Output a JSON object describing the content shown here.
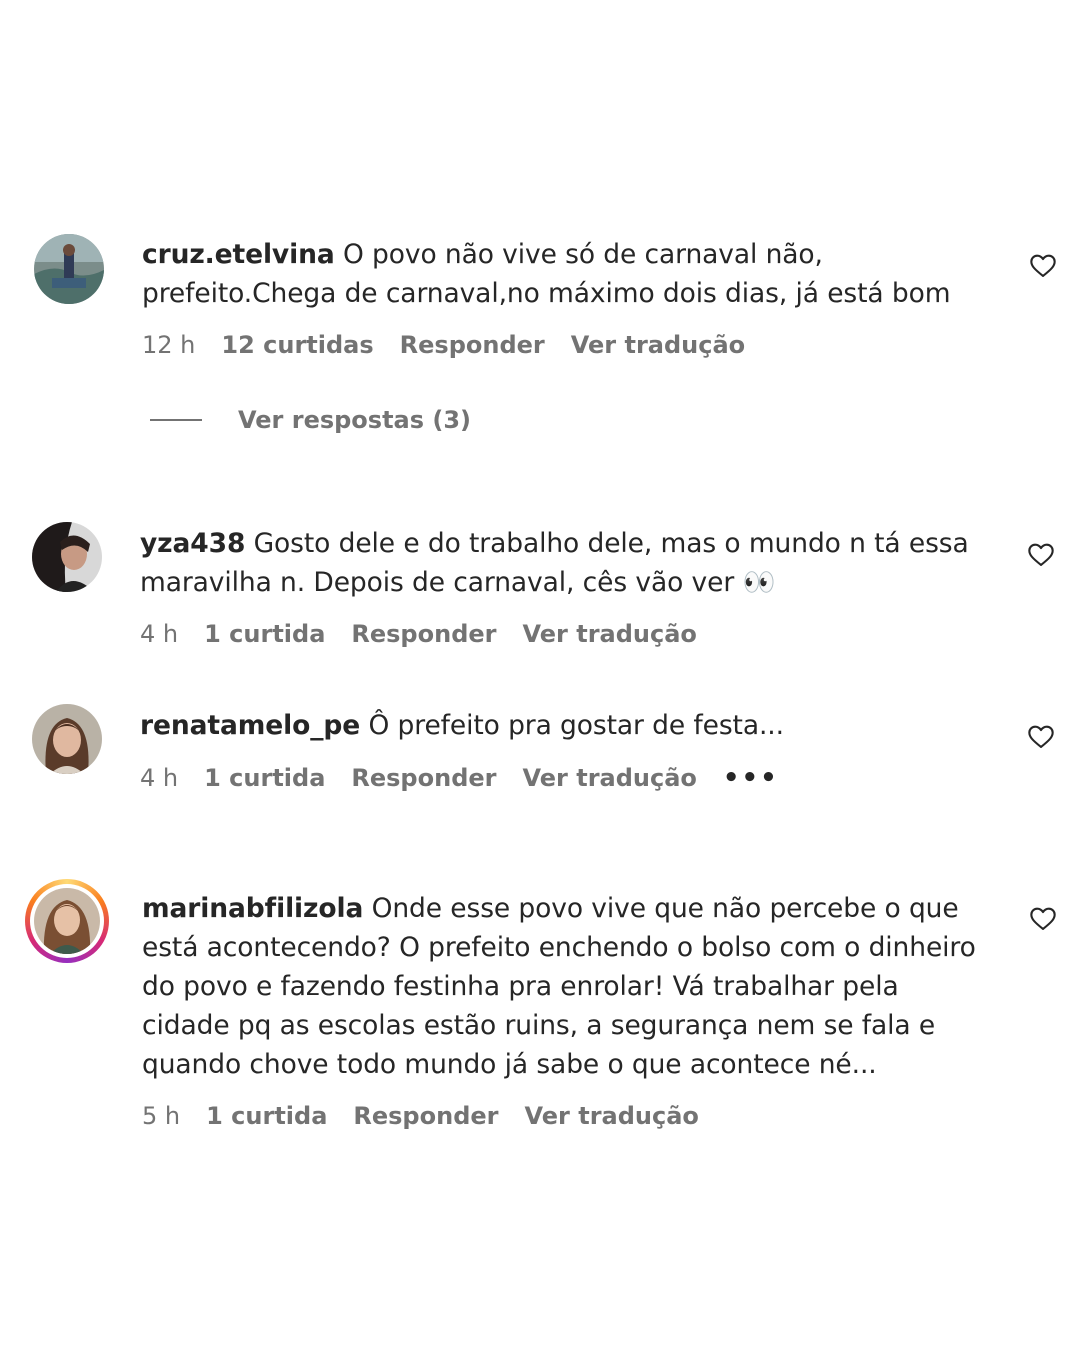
{
  "comments": [
    {
      "username": "cruz.etelvina",
      "text": "O povo não vive só de carnaval não, prefeito.Chega de carnaval,no máximo dois dias, já está bom",
      "time": "12 h",
      "likes": "12 curtidas",
      "reply": "Responder",
      "translate": "Ver tradução",
      "view_replies": "Ver respostas (3)"
    },
    {
      "username": "yza438",
      "text": "Gosto dele e do trabalho dele, mas o mundo n tá essa maravilha n. Depois de carnaval, cês vão ver 👀",
      "time": "4 h",
      "likes": "1 curtida",
      "reply": "Responder",
      "translate": "Ver tradução"
    },
    {
      "username": "renatamelo_pe",
      "text": "Ô prefeito pra gostar de festa...",
      "time": "4 h",
      "likes": "1 curtida",
      "reply": "Responder",
      "translate": "Ver tradução",
      "more": "•••"
    },
    {
      "username": "marinabfilizola",
      "text": "Onde esse povo vive que não percebe o que está acontecendo? O prefeito enchendo o bolso com o dinheiro do povo e fazendo festinha pra enrolar! Vá trabalhar pela cidade pq as escolas estão ruins, a segurança nem se fala e quando chove todo mundo já sabe o que acontece né...",
      "time": "5 h",
      "likes": "1 curtida",
      "reply": "Responder",
      "translate": "Ver tradução"
    }
  ],
  "icons": {
    "like": "heart-icon",
    "more": "more-options-icon"
  },
  "colors": {
    "text": "#262626",
    "secondary": "#737373",
    "background": "#ffffff"
  }
}
